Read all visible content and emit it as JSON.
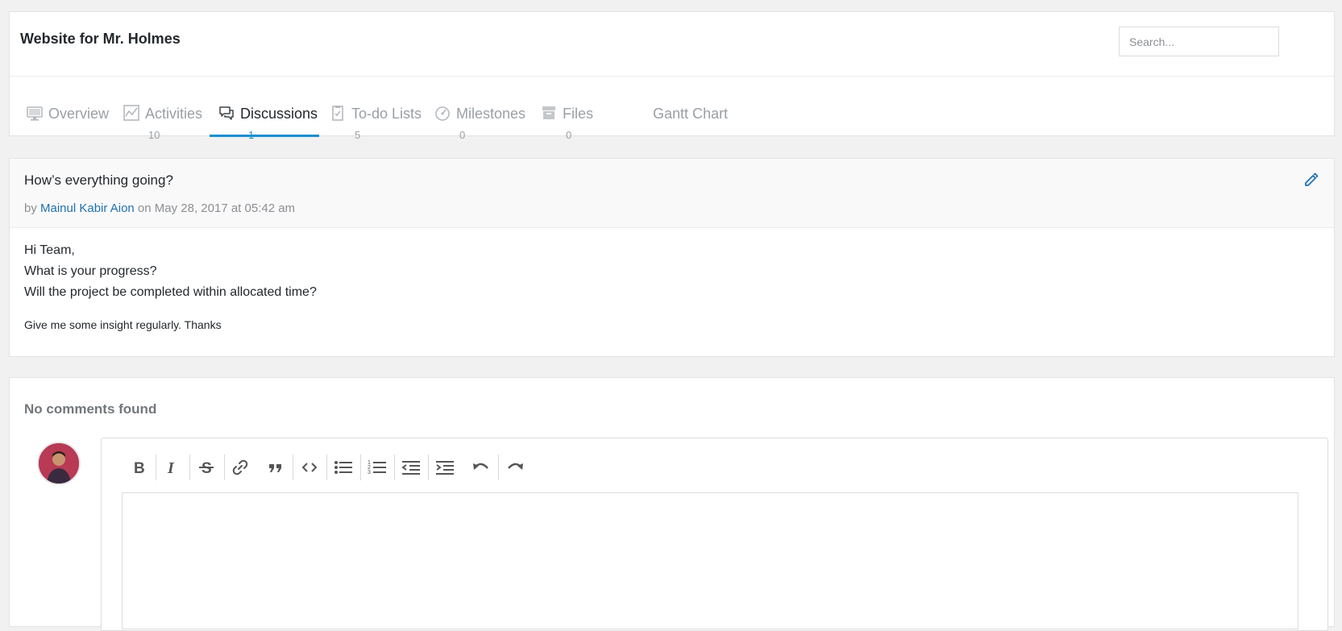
{
  "project": {
    "title": "Website for Mr. Holmes"
  },
  "search": {
    "placeholder": "Search..."
  },
  "tabs": [
    {
      "label": "Overview",
      "count": "",
      "icon": "monitor-icon",
      "active": false
    },
    {
      "label": "Activities",
      "count": "10",
      "icon": "activity-chart-icon",
      "active": false
    },
    {
      "label": "Discussions",
      "count": "1",
      "icon": "chat-bubbles-icon",
      "active": true
    },
    {
      "label": "To-do Lists",
      "count": "5",
      "icon": "clipboard-icon",
      "active": false
    },
    {
      "label": "Milestones",
      "count": "0",
      "icon": "gauge-icon",
      "active": false
    },
    {
      "label": "Files",
      "count": "0",
      "icon": "archive-box-icon",
      "active": false
    },
    {
      "label": "Gantt Chart",
      "count": "",
      "icon": "",
      "active": false
    }
  ],
  "discussion": {
    "title": "How’s everything going?",
    "meta_by": "by",
    "author": "Mainul Kabir Aion",
    "meta_on": "on May 28, 2017 at 05:42 am",
    "body_lines": [
      "Hi Team,",
      "What is your progress?",
      "Will the project be completed within allocated time?"
    ],
    "footer_line": "Give me some insight regularly. Thanks"
  },
  "comments": {
    "empty_text": "No comments found"
  },
  "editor_toolbar": [
    "bold-icon",
    "italic-icon",
    "strikethrough-icon",
    "link-icon",
    "blockquote-icon",
    "code-icon",
    "bullet-list-icon",
    "numbered-list-icon",
    "outdent-icon",
    "indent-icon",
    "undo-icon",
    "redo-icon"
  ],
  "colors": {
    "accent": "#1a8fcf",
    "link": "#2271b1",
    "muted": "#9aa0a6",
    "background": "#f1f1f1"
  }
}
